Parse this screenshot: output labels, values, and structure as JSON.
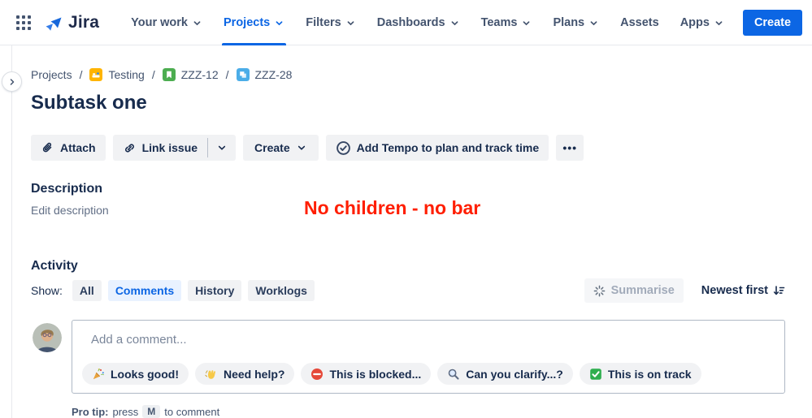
{
  "header": {
    "logo_text": "Jira",
    "nav": [
      {
        "label": "Your work"
      },
      {
        "label": "Projects"
      },
      {
        "label": "Filters"
      },
      {
        "label": "Dashboards"
      },
      {
        "label": "Teams"
      },
      {
        "label": "Plans"
      },
      {
        "label": "Assets"
      },
      {
        "label": "Apps"
      }
    ],
    "active_nav": "Projects",
    "create_label": "Create"
  },
  "breadcrumb": {
    "separator": "/",
    "items": [
      {
        "label": "Projects",
        "icon": null
      },
      {
        "label": "Testing",
        "icon": "project-avatar-icon"
      },
      {
        "label": "ZZZ-12",
        "icon": "story-icon"
      },
      {
        "label": "ZZZ-28",
        "icon": "subtask-icon"
      }
    ]
  },
  "page": {
    "title": "Subtask one"
  },
  "toolbar": {
    "attach_label": "Attach",
    "link_issue_label": "Link issue",
    "create_label": "Create",
    "tempo_label": "Add Tempo to plan and track time",
    "more_label": "•••"
  },
  "description": {
    "heading": "Description",
    "edit_label": "Edit description",
    "annotation": "No children - no bar",
    "annotation_color": "#FF1E00"
  },
  "activity": {
    "heading": "Activity",
    "show_label": "Show:",
    "filters": [
      {
        "label": "All",
        "active": false
      },
      {
        "label": "Comments",
        "active": true
      },
      {
        "label": "History",
        "active": false
      },
      {
        "label": "Worklogs",
        "active": false
      }
    ],
    "summarise_label": "Summarise",
    "summarise_disabled": true,
    "sort_label": "Newest first"
  },
  "comment": {
    "placeholder": "Add a comment...",
    "quick_replies": [
      {
        "icon": "party-popper-icon",
        "label": "Looks good!"
      },
      {
        "icon": "waving-hand-icon",
        "label": "Need help?"
      },
      {
        "icon": "no-entry-icon",
        "label": "This is blocked..."
      },
      {
        "icon": "magnifier-icon",
        "label": "Can you clarify...?"
      },
      {
        "icon": "green-check-icon",
        "label": "This is on track"
      }
    ],
    "pro_tip_bold": "Pro tip:",
    "pro_tip_press": "press",
    "pro_tip_key": "M",
    "pro_tip_rest": "to comment"
  },
  "colors": {
    "accent_blue": "#0C66E4",
    "navy_text": "#172B4D",
    "secondary_text": "#44546F",
    "muted_text": "#626F86",
    "button_bg": "#F1F2F4",
    "chip_active_bg": "#E9F2FF",
    "annotation_red": "#FF1E00",
    "story_green": "#4CAD50",
    "subtask_blue": "#4BADE8",
    "project_yellow": "#FFB400"
  }
}
